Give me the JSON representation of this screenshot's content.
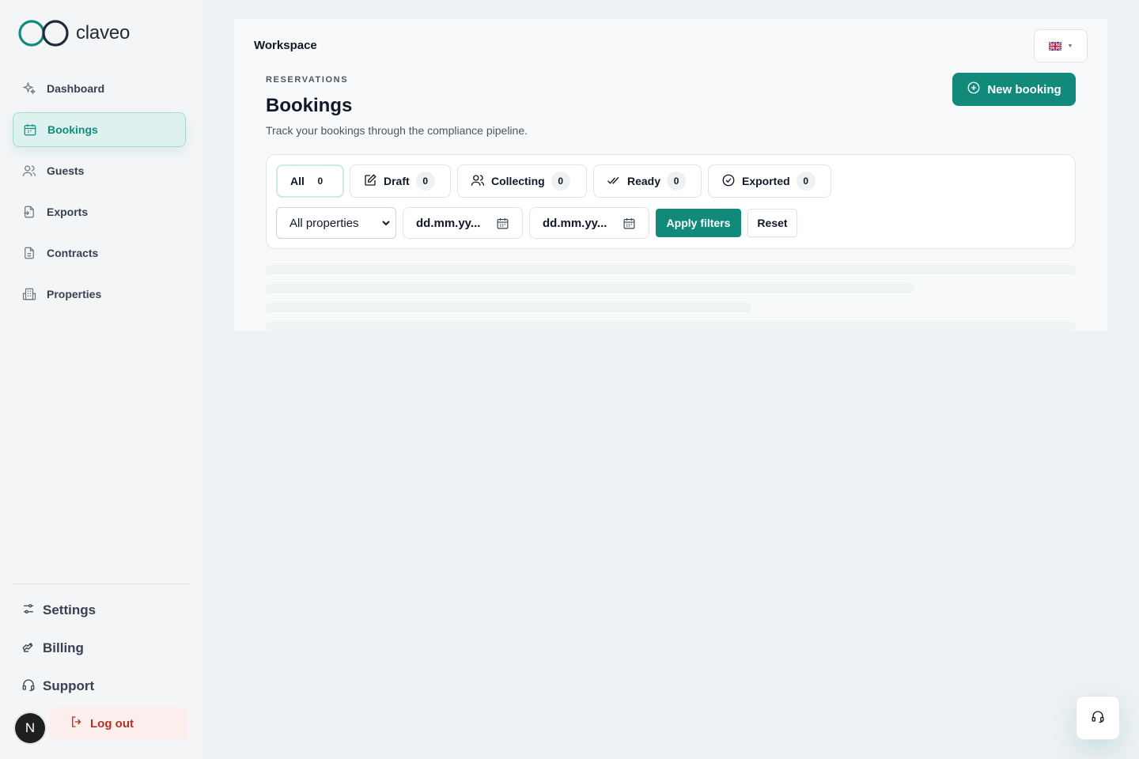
{
  "brand": {
    "name": "claveo",
    "accent": "#118a7c"
  },
  "sidebar": {
    "items": [
      {
        "label": "Dashboard",
        "icon": "sparkles-icon"
      },
      {
        "label": "Bookings",
        "icon": "calendar-icon",
        "active": true
      },
      {
        "label": "Guests",
        "icon": "users-icon"
      },
      {
        "label": "Exports",
        "icon": "export-file-icon"
      },
      {
        "label": "Contracts",
        "icon": "document-icon"
      },
      {
        "label": "Properties",
        "icon": "building-icon"
      }
    ],
    "bottom": [
      {
        "label": "Settings",
        "icon": "sliders-icon"
      },
      {
        "label": "Billing",
        "icon": "billing-icon"
      },
      {
        "label": "Support",
        "icon": "headset-icon"
      }
    ],
    "logout_label": "Log out",
    "avatar_initial": "N"
  },
  "header": {
    "workspace": "Workspace",
    "language_flag": "uk-flag-icon"
  },
  "page": {
    "overline": "RESERVATIONS",
    "title": "Bookings",
    "subtitle": "Track your bookings through the compliance pipeline.",
    "new_button": "New booking"
  },
  "tabs": [
    {
      "label": "All",
      "count": "0",
      "active": true
    },
    {
      "label": "Draft",
      "count": "0",
      "icon": "edit-icon"
    },
    {
      "label": "Collecting",
      "count": "0",
      "icon": "users-icon"
    },
    {
      "label": "Ready",
      "count": "0",
      "icon": "double-check-icon"
    },
    {
      "label": "Exported",
      "count": "0",
      "icon": "check-circle-icon"
    }
  ],
  "filters": {
    "property_select": "All properties",
    "date_from": "dd.mm.yy...",
    "date_to": "dd.mm.yy...",
    "apply_label": "Apply filters",
    "reset_label": "Reset"
  }
}
